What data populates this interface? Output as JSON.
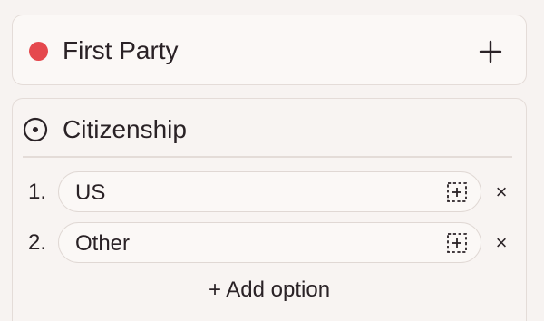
{
  "party": {
    "title": "First Party",
    "dot_color": "#e5484d",
    "add_icon": "plus-icon"
  },
  "question": {
    "icon": "radio-circle-icon",
    "title": "Citizenship",
    "options": [
      {
        "number": "1.",
        "label": "US",
        "insert_icon": "dashed-plus-icon",
        "remove_glyph": "×"
      },
      {
        "number": "2.",
        "label": "Other",
        "insert_icon": "dashed-plus-icon",
        "remove_glyph": "×"
      }
    ],
    "add_option_label": "+ Add option"
  }
}
